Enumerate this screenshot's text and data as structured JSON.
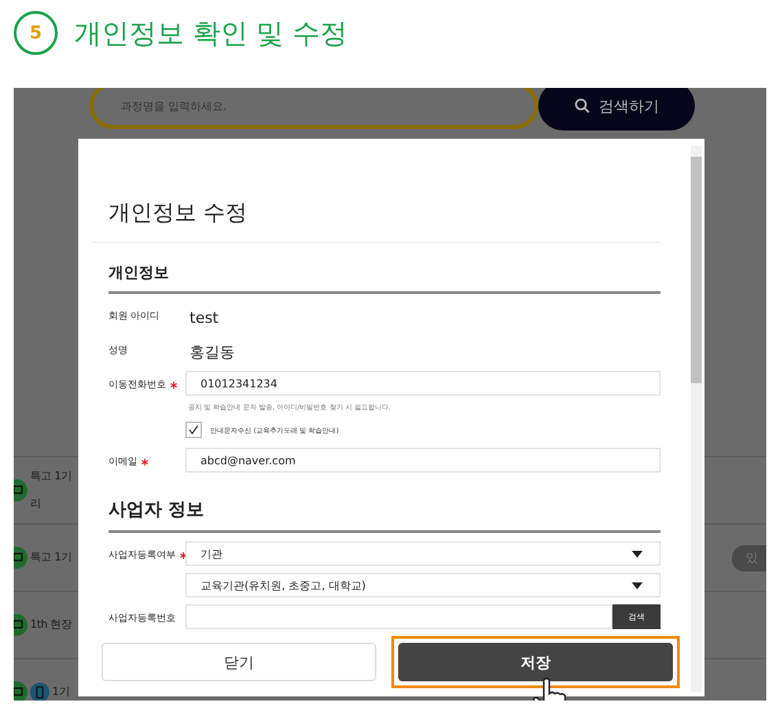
{
  "step": {
    "number": "5",
    "title": "개인정보 확인 및 수정"
  },
  "background": {
    "search": {
      "placeholder": "과정명을 입력하세요.",
      "button": "검색하기"
    },
    "rows": [
      {
        "lines": [
          "특고 1기",
          "리"
        ],
        "kind": "pc",
        "badge": null
      },
      {
        "lines": [
          "특고 1기"
        ],
        "kind": "pc",
        "badge": "있"
      },
      {
        "lines": [
          "1th 현장"
        ],
        "kind": "pc",
        "badge": null
      },
      {
        "lines": [
          "1기"
        ],
        "kind": "pc-mobile",
        "badge": null
      }
    ]
  },
  "modal": {
    "title": "개인정보 수정",
    "sections": [
      {
        "heading": "개인정보",
        "fields": [
          {
            "kind": "text",
            "label": "회원 아이디",
            "value": "test"
          },
          {
            "kind": "text",
            "label": "성명",
            "value": "홍길동"
          },
          {
            "kind": "input",
            "label": "이동전화번호",
            "required": true,
            "value": "01012341234",
            "hint": "공지 및 학습안내 문자 발송, 아이디/비밀번호 찾기 시 필요합니다."
          },
          {
            "kind": "checkbox",
            "label": "안내문자수신 (교육추가도래 및 학습안내)",
            "checked": true
          },
          {
            "kind": "input",
            "label": "이메일",
            "required": true,
            "value": "abcd@naver.com"
          }
        ]
      },
      {
        "heading": "사업자 정보",
        "fields": [
          {
            "kind": "select",
            "label": "사업자등록여부",
            "required": true,
            "value": "기관"
          },
          {
            "kind": "select",
            "value": "교육기관(유치원, 초중고, 대학교)"
          },
          {
            "kind": "search",
            "label": "사업자등록번호",
            "button": "검색"
          }
        ]
      }
    ],
    "buttons": [
      {
        "label": "닫기",
        "kind": "secondary",
        "highlighted": false
      },
      {
        "label": "저장",
        "kind": "primary",
        "highlighted": true
      }
    ]
  }
}
